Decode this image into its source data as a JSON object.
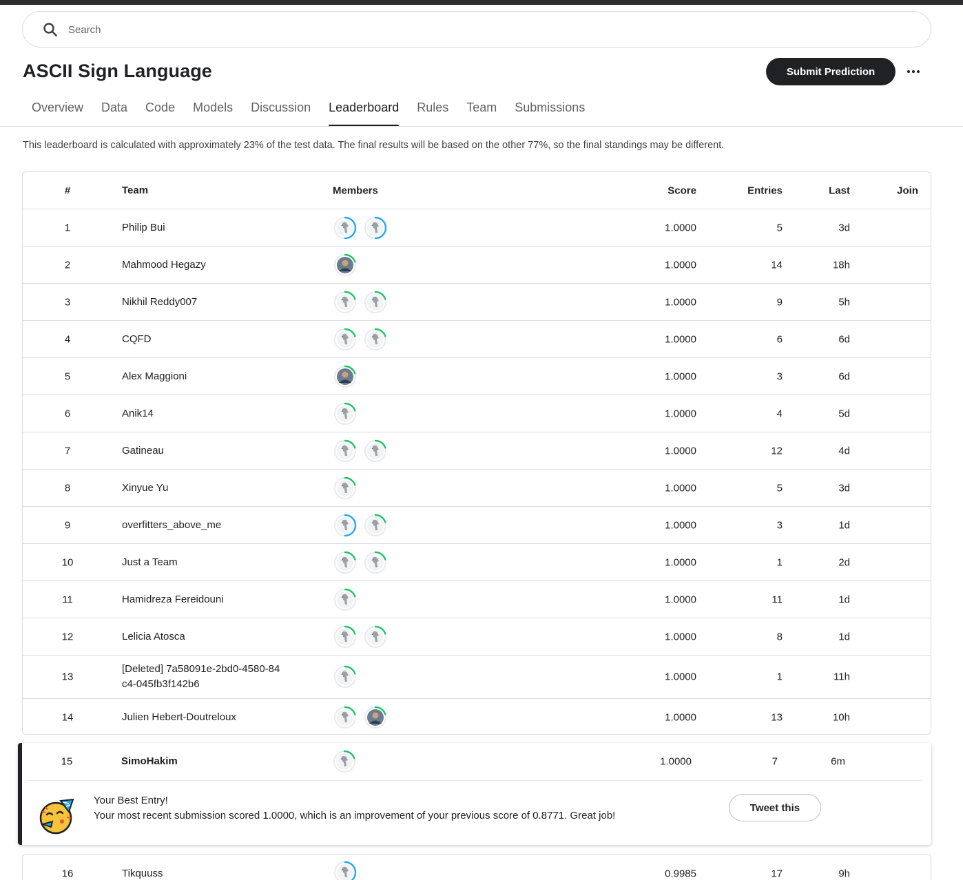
{
  "search": {
    "placeholder": "Search"
  },
  "competition": {
    "title": "ASCII Sign Language"
  },
  "actions": {
    "submit_label": "Submit Prediction",
    "more_icon": "more-horizontal-icon"
  },
  "tabs": [
    {
      "label": "Overview"
    },
    {
      "label": "Data"
    },
    {
      "label": "Code"
    },
    {
      "label": "Models"
    },
    {
      "label": "Discussion"
    },
    {
      "label": "Leaderboard",
      "active": true
    },
    {
      "label": "Rules"
    },
    {
      "label": "Team"
    },
    {
      "label": "Submissions"
    }
  ],
  "notice": "This leaderboard is calculated with approximately 23% of the test data. The final results will be based on the other 77%, so the final standings may be different.",
  "leaderboard": {
    "columns": {
      "rank": "#",
      "team": "Team",
      "members": "Members",
      "score": "Score",
      "entries": "Entries",
      "last": "Last",
      "join": "Join"
    },
    "rows": [
      {
        "rank": "1",
        "team": "Philip Bui",
        "members": [
          "blue",
          "blue"
        ],
        "score": "1.0000",
        "entries": "5",
        "last": "3d"
      },
      {
        "rank": "2",
        "team": "Mahmood Hegazy",
        "members": [
          "photo-green"
        ],
        "score": "1.0000",
        "entries": "14",
        "last": "18h"
      },
      {
        "rank": "3",
        "team": "Nikhil Reddy007",
        "members": [
          "green",
          "green"
        ],
        "score": "1.0000",
        "entries": "9",
        "last": "5h"
      },
      {
        "rank": "4",
        "team": "CQFD",
        "members": [
          "green",
          "green"
        ],
        "score": "1.0000",
        "entries": "6",
        "last": "6d"
      },
      {
        "rank": "5",
        "team": "Alex Maggioni",
        "members": [
          "photo-green"
        ],
        "score": "1.0000",
        "entries": "3",
        "last": "6d"
      },
      {
        "rank": "6",
        "team": "Anik14",
        "members": [
          "green"
        ],
        "score": "1.0000",
        "entries": "4",
        "last": "5d"
      },
      {
        "rank": "7",
        "team": "Gatineau",
        "members": [
          "green",
          "green"
        ],
        "score": "1.0000",
        "entries": "12",
        "last": "4d"
      },
      {
        "rank": "8",
        "team": "Xinyue Yu",
        "members": [
          "green"
        ],
        "score": "1.0000",
        "entries": "5",
        "last": "3d"
      },
      {
        "rank": "9",
        "team": "overfitters_above_me",
        "members": [
          "blue",
          "green"
        ],
        "score": "1.0000",
        "entries": "3",
        "last": "1d"
      },
      {
        "rank": "10",
        "team": "Just a Team",
        "members": [
          "green",
          "green"
        ],
        "score": "1.0000",
        "entries": "1",
        "last": "2d"
      },
      {
        "rank": "11",
        "team": "Hamidreza Fereidouni",
        "members": [
          "green"
        ],
        "score": "1.0000",
        "entries": "11",
        "last": "1d"
      },
      {
        "rank": "12",
        "team": "Lelicia Atosca",
        "members": [
          "green",
          "green"
        ],
        "score": "1.0000",
        "entries": "8",
        "last": "1d"
      },
      {
        "rank": "13",
        "team": "[Deleted] 7a58091e-2bd0-4580-84c4-045fb3f142b6",
        "team_line1": "[Deleted] 7a58091e-2bd0-4580-84",
        "team_line2": "c4-045fb3f142b6",
        "members": [
          "green"
        ],
        "score": "1.0000",
        "entries": "1",
        "last": "11h"
      },
      {
        "rank": "14",
        "team": "Julien Hebert-Doutreloux",
        "members": [
          "green",
          "photo-green"
        ],
        "score": "1.0000",
        "entries": "13",
        "last": "10h"
      }
    ],
    "my_entry": {
      "rank": "15",
      "team": "SimoHakim",
      "members": [
        "green"
      ],
      "score": "1.0000",
      "entries": "7",
      "last": "6m"
    },
    "best_entry": {
      "icon": "party-face-icon",
      "title": "Your Best Entry!",
      "text": "Your most recent submission scored 1.0000, which is an improvement of your previous score of 0.8771. Great job!",
      "tweet_label": "Tweet this"
    },
    "next_row": {
      "rank": "16",
      "team": "Tikquuss",
      "members": [
        "blue"
      ],
      "score": "0.9985",
      "entries": "17",
      "last": "9h"
    }
  },
  "colors": {
    "tier_green": "#20beff",
    "progress_green": "#1ec462",
    "progress_blue": "#20a8f0",
    "dark": "#202124"
  }
}
